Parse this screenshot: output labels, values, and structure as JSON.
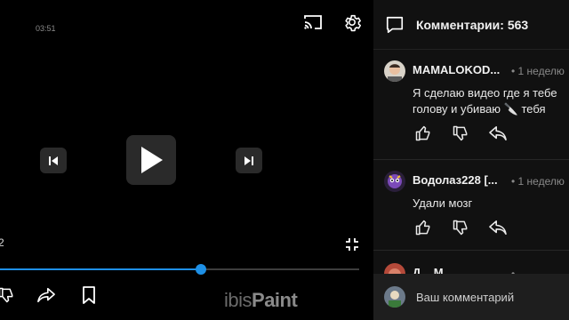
{
  "player": {
    "clock": "03:51",
    "cut_time": "2",
    "progress": 0.56,
    "watermark_regular": "ibis",
    "watermark_bold": "Paint",
    "accent_color": "#1e90e6",
    "icons": {
      "cast": "cast-icon",
      "settings": "gear-icon",
      "previous": "skip-previous-icon",
      "play": "play-icon",
      "next": "skip-next-icon",
      "fullscreen": "exit-fullscreen-icon",
      "dislike": "thumb-down-icon",
      "share": "share-icon",
      "save": "bookmark-icon"
    }
  },
  "comments": {
    "title": "Комментарии: 563",
    "header_icon": "comment-icon",
    "items": [
      {
        "author": "MAMALOKOD...",
        "date": "• 1 неделю",
        "text": "Я сделаю видео где я тебе голову и убиваю 🔪 тебя"
      },
      {
        "author": "Водолаз228 [...",
        "date": "• 1 неделю",
        "text": "Удали мозг"
      },
      {
        "author": "Д... М...",
        "date": "•",
        "text": ""
      }
    ],
    "action_icons": [
      "thumb-up-icon",
      "thumb-down-icon",
      "reply-icon"
    ],
    "composer_placeholder": "Ваш комментарий"
  }
}
